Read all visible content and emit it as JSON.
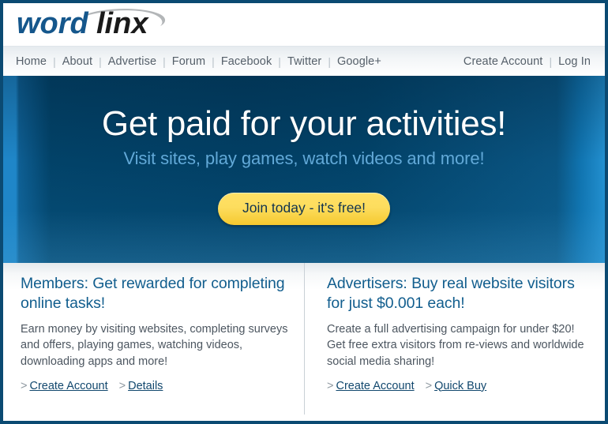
{
  "site": {
    "logo_word": "word",
    "logo_linx": "linx",
    "logo_alt": "wordlinx"
  },
  "nav": {
    "separator": "|",
    "left_items": [
      {
        "label": "Home",
        "name": "nav-home"
      },
      {
        "label": "About",
        "name": "nav-about"
      },
      {
        "label": "Advertise",
        "name": "nav-advertise"
      },
      {
        "label": "Forum",
        "name": "nav-forum"
      },
      {
        "label": "Facebook",
        "name": "nav-facebook"
      },
      {
        "label": "Twitter",
        "name": "nav-twitter"
      },
      {
        "label": "Google+",
        "name": "nav-googleplus"
      }
    ],
    "right_items": [
      {
        "label": "Create Account",
        "name": "nav-create-account"
      },
      {
        "label": "Log In",
        "name": "nav-log-in"
      }
    ]
  },
  "hero": {
    "title": "Get paid for your activities!",
    "subtitle": "Visit sites, play games, watch videos and more!",
    "button_label": "Join today - it's free!"
  },
  "panels": [
    {
      "title": "Members: Get rewarded for completing online tasks!",
      "body": "Earn money by visiting websites, completing surveys and offers, playing games, watching videos, downloading apps and more!",
      "caret": ">",
      "links": [
        {
          "label": "Create Account"
        },
        {
          "label": "Details"
        }
      ]
    },
    {
      "title": "Advertisers: Buy real website visitors for just $0.001 each!",
      "body": "Create a full advertising campaign for under $20! Get free extra visitors from re-views and worldwide social media sharing!",
      "caret": ">",
      "links": [
        {
          "label": "Create Account"
        },
        {
          "label": "Quick Buy"
        }
      ]
    }
  ],
  "colors": {
    "frame_border": "#0b4a72",
    "logo_blue": "#15578c",
    "logo_dark": "#1a1a1a",
    "logo_swoosh": "#b3b6b8",
    "hero_dark": "#024268",
    "hero_edge": "#2390d0",
    "hero_subtitle": "#62a9d8",
    "button_yellow": "#fddd5e",
    "button_text": "#12344f",
    "panel_title": "#125e8e",
    "panel_body": "#4c5660",
    "link": "#12486e",
    "nav_text": "#56606a"
  }
}
